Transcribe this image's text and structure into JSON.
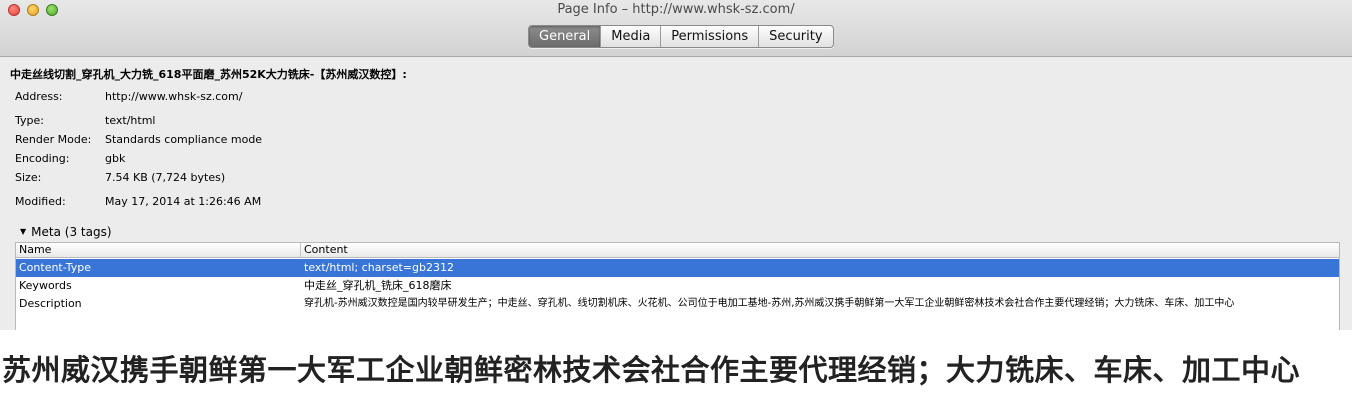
{
  "window": {
    "title": "Page Info – http://www.whsk-sz.com/",
    "tabs": [
      {
        "label": "General",
        "active": true
      },
      {
        "label": "Media",
        "active": false
      },
      {
        "label": "Permissions",
        "active": false
      },
      {
        "label": "Security",
        "active": false
      }
    ]
  },
  "general": {
    "page_title": "中走丝线切割_穿孔机_大力铣_618平面磨_苏州52K大力铣床-【苏州威汉数控】:",
    "fields": [
      {
        "label": "Address:",
        "value": "http://www.whsk-sz.com/"
      },
      {
        "label": "Type:",
        "value": "text/html"
      },
      {
        "label": "Render Mode:",
        "value": "Standards compliance mode"
      },
      {
        "label": "Encoding:",
        "value": "gbk"
      },
      {
        "label": "Size:",
        "value": "7.54 KB (7,724 bytes)"
      },
      {
        "label": "Modified:",
        "value": "May 17, 2014 at 1:26:46 AM"
      }
    ]
  },
  "meta": {
    "header": "Meta (3 tags)",
    "columns": {
      "name": "Name",
      "content": "Content"
    },
    "rows": [
      {
        "name": "Content-Type",
        "content": "text/html; charset=gb2312",
        "selected": true
      },
      {
        "name": "Keywords",
        "content": "中走丝_穿孔机_铣床_618磨床",
        "selected": false
      },
      {
        "name": "Description",
        "content": "穿孔机-苏州威汉数控是国内较早研发生产；中走丝、穿孔机、线切割机床、火花机、公司位于电加工基地-苏州,苏州威汉携手朝鲜第一大军工企业朝鲜密林技术会社合作主要代理经销；大力铣床、车床、加工中心",
        "selected": false
      }
    ]
  },
  "zoom_caption": "苏州威汉携手朝鲜第一大军工企业朝鲜密林技术会社合作主要代理经销；大力铣床、车床、加工中心",
  "colors": {
    "selection": "#3875d7",
    "active_tab": "#7a7a7a"
  }
}
